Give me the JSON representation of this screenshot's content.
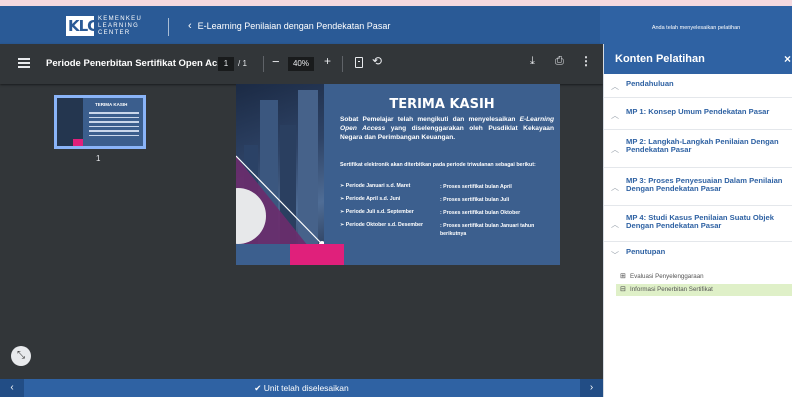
{
  "header": {
    "logo_mark": "KLC",
    "logo_text": [
      "KEMENKEU",
      "LEARNING",
      "CENTER"
    ],
    "course_title": "E-Learning Penilaian dengan Pendekatan Pasar",
    "status": "Anda telah menyelesaikan pelatihan"
  },
  "pdf_toolbar": {
    "menu_icon": "menu-icon",
    "doc_title": "Periode Penerbitan Sertifikat Open Ac...",
    "current_page": "1",
    "page_sep": "/ 1",
    "zoom_out": "−",
    "zoom": "40%",
    "zoom_in": "+",
    "fit_icon": "fit-page-icon",
    "rotate_icon": "rotate-icon",
    "download_icon": "download-icon",
    "print_icon": "print-icon",
    "more_icon": "more-vert-icon"
  },
  "thumbnail": {
    "title": "TERIMA KASIH",
    "page_number": "1"
  },
  "slide": {
    "title": "TERIMA KASIH",
    "intro_1": "Sobat Pemelajar telah mengikuti dan menyelesaikan",
    "intro_em": "E-Learning Open Access",
    "intro_2": "yang diselenggarakan oleh Pusdiklat Kekayaan Negara dan Perimbangan Keuangan.",
    "note": "Sertifikat elektronik akan diterbitkan pada periode triwulanan sebagai berikut:",
    "rows": [
      {
        "period": "➢  Periode Januari s.d. Maret",
        "process": ": Proses sertifikat bulan April"
      },
      {
        "period": "➢  Periode April s.d. Juni",
        "process": ": Proses sertifikat bulan Juli"
      },
      {
        "period": "➢  Periode Juli s.d. September",
        "process": ": Proses sertifikat bulan Oktober"
      },
      {
        "period": "➢  Periode Oktober s.d. Desember",
        "process": ": Proses sertifikat bulan Januari tahun berikutnya"
      }
    ]
  },
  "bottom_bar": {
    "prev": "‹",
    "next": "›",
    "status": "✔ Unit telah diselesaikan"
  },
  "restore_icon": "collapse-arrows-icon",
  "sidebar": {
    "title": "Konten Pelatihan",
    "close": "×",
    "items": [
      {
        "label": "Pendahuluan",
        "chevron": "up"
      },
      {
        "label": "MP 1: Konsep Umum Pendekatan Pasar",
        "chevron": "up"
      },
      {
        "label": "MP 2: Langkah-Langkah Penilaian Dengan Pendekatan Pasar",
        "chevron": "up"
      },
      {
        "label": "MP 3: Proses Penyesuaian Dalam Penilaian Dengan Pendekatan Pasar",
        "chevron": "up"
      },
      {
        "label": "MP 4: Studi Kasus Penilaian Suatu Objek Dengan Pendekatan Pasar",
        "chevron": "up"
      },
      {
        "label": "Penutupan",
        "chevron": "down"
      }
    ],
    "sub_items": [
      {
        "label": "Evaluasi Penyelenggaraan",
        "icon": "form-icon",
        "active": false
      },
      {
        "label": "Informasi Penerbitan Sertifikat",
        "icon": "document-icon",
        "active": true
      }
    ]
  },
  "colors": {
    "header_blue": "#2a5a96",
    "accent_blue": "#2f62a3",
    "viewer_dark": "#323639",
    "slide_blue": "#3c5f8e",
    "slide_pink": "#e0207b",
    "active_green": "#dff0c8"
  }
}
